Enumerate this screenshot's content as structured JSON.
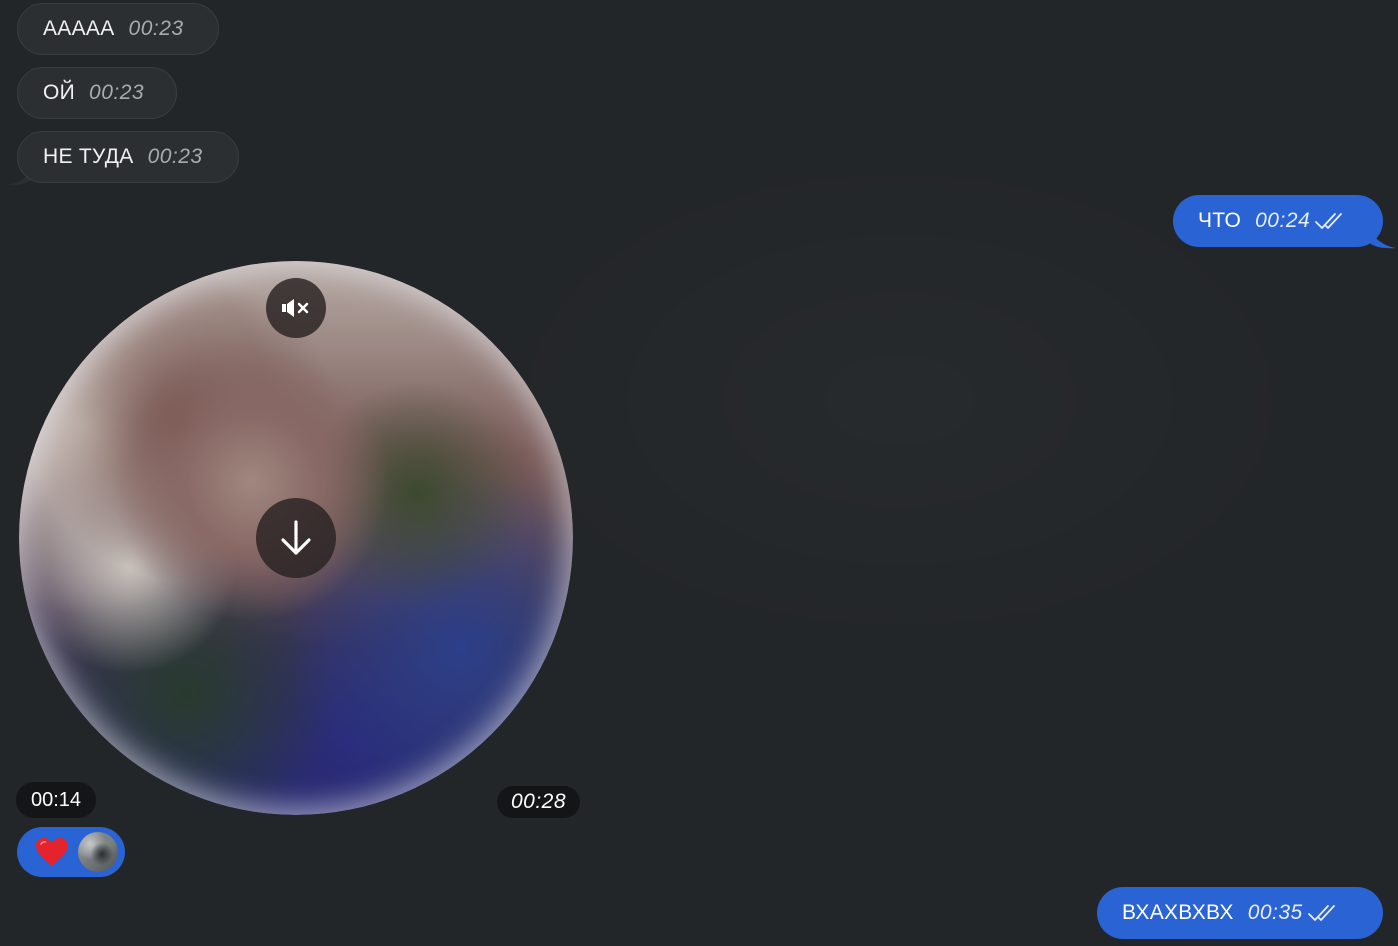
{
  "messages_in": [
    {
      "text": "ААААА",
      "time": "00:23"
    },
    {
      "text": "ОЙ",
      "time": "00:23"
    },
    {
      "text": "НЕ ТУДА",
      "time": "00:23"
    }
  ],
  "messages_out": [
    {
      "text": "ЧТО",
      "time": "00:24",
      "status": "read"
    },
    {
      "text": "ВХАХВХВХ",
      "time": "00:35",
      "status": "read"
    }
  ],
  "video_message": {
    "duration": "00:14",
    "time": "00:28",
    "muted_icon": "speaker-muted-icon",
    "download_icon": "arrow-down-icon"
  },
  "reaction": {
    "emoji_icon": "red-heart-icon",
    "avatar": "reactor-avatar"
  },
  "colors": {
    "background": "#232629",
    "incoming_bubble": "#2c2f32",
    "outgoing_bubble": "#2a63d4"
  }
}
